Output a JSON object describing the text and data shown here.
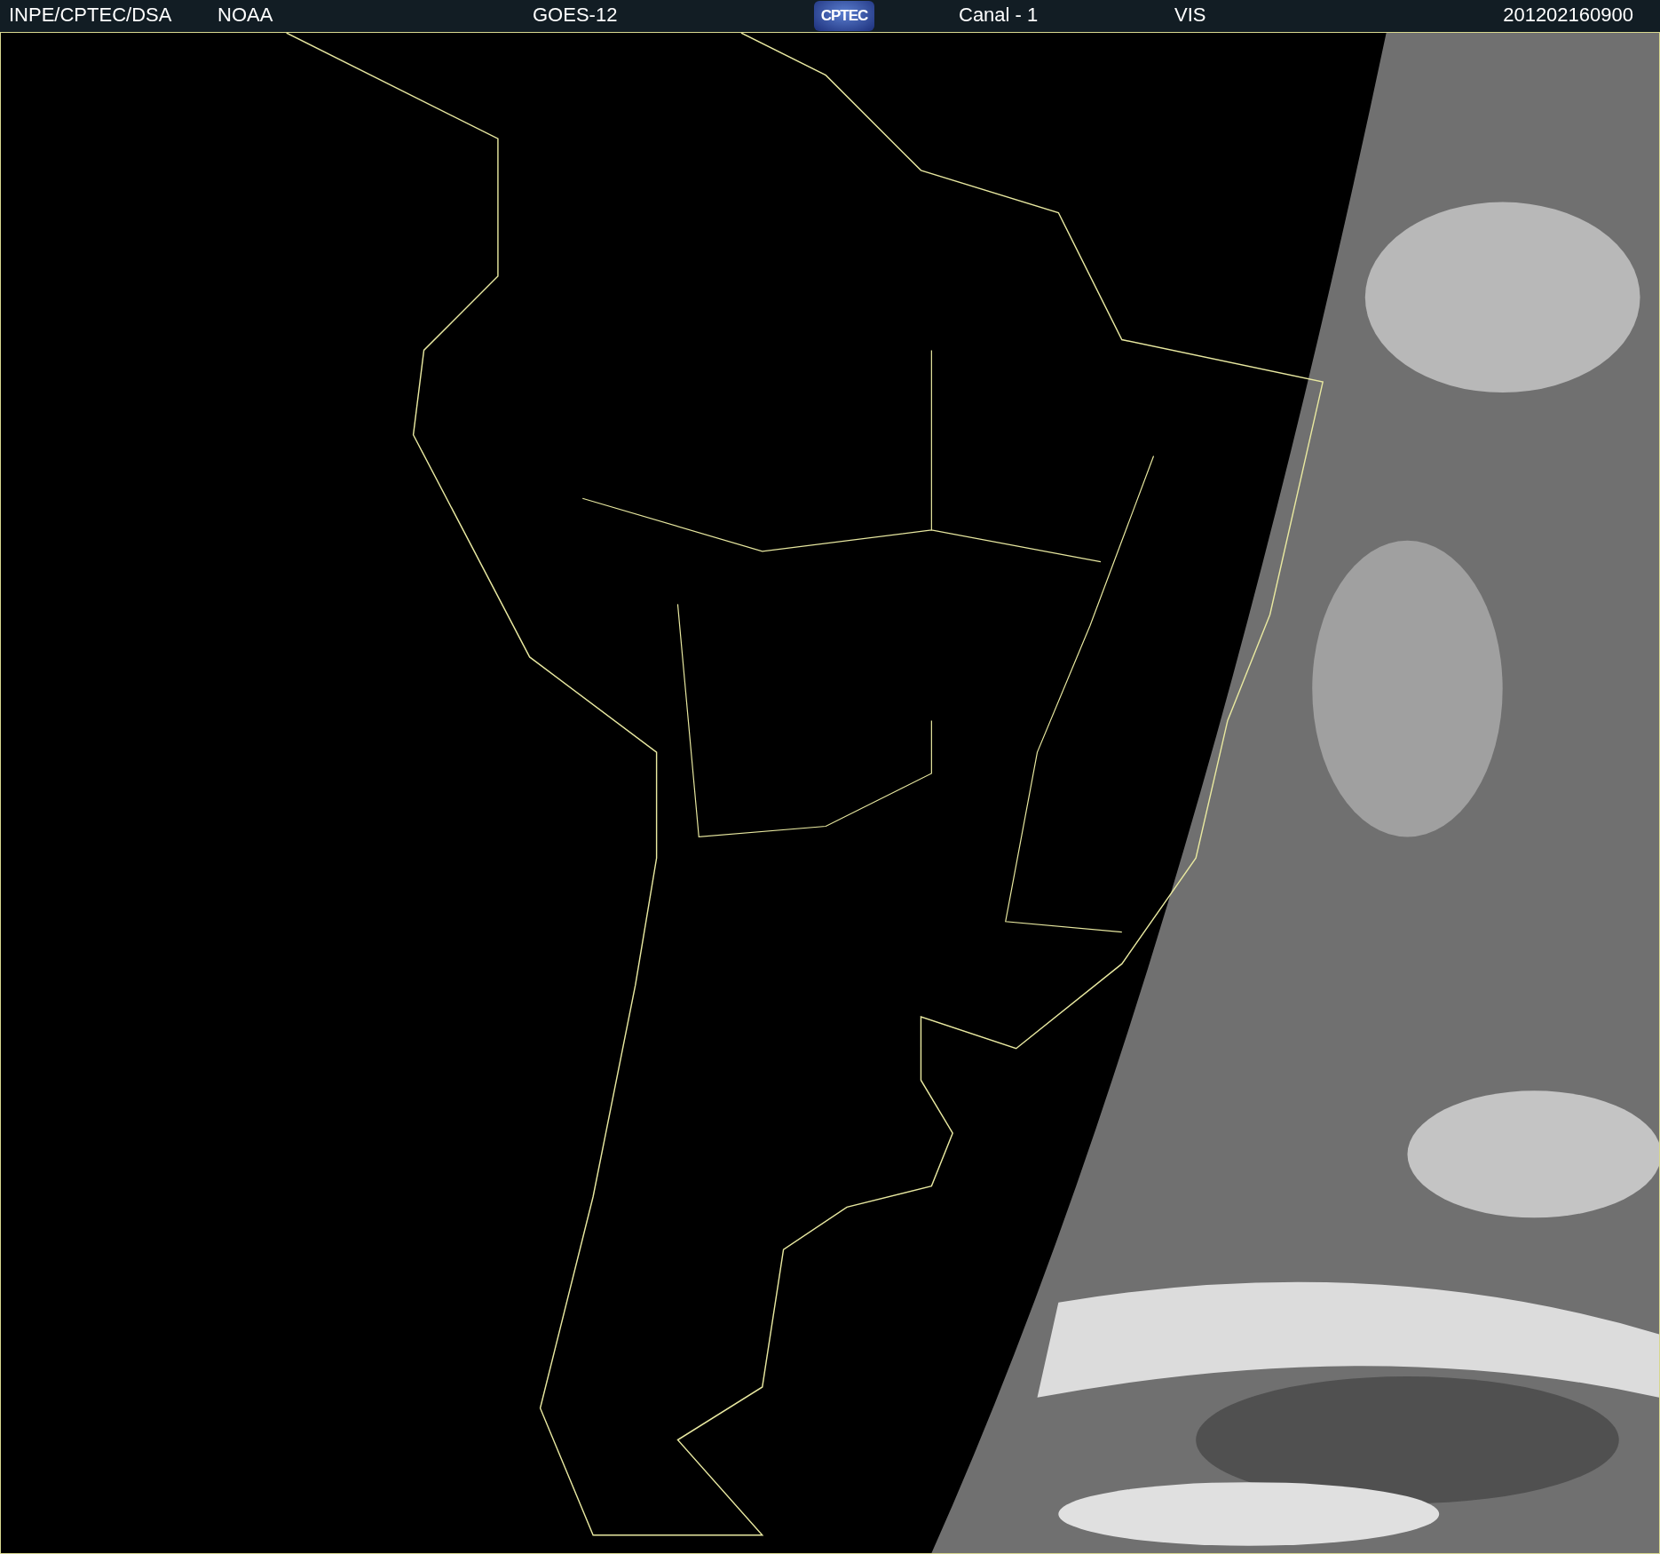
{
  "header": {
    "items": [
      {
        "kind": "text",
        "text": "INPE/CPTEC/DSA"
      },
      {
        "kind": "text",
        "text": "NOAA"
      },
      {
        "kind": "text",
        "text": "GOES-12"
      },
      {
        "kind": "logo",
        "text": "CPTEC"
      },
      {
        "kind": "text",
        "text": "Canal - 1"
      },
      {
        "kind": "text",
        "text": "VIS"
      },
      {
        "kind": "text",
        "text": "201202160900"
      }
    ]
  }
}
